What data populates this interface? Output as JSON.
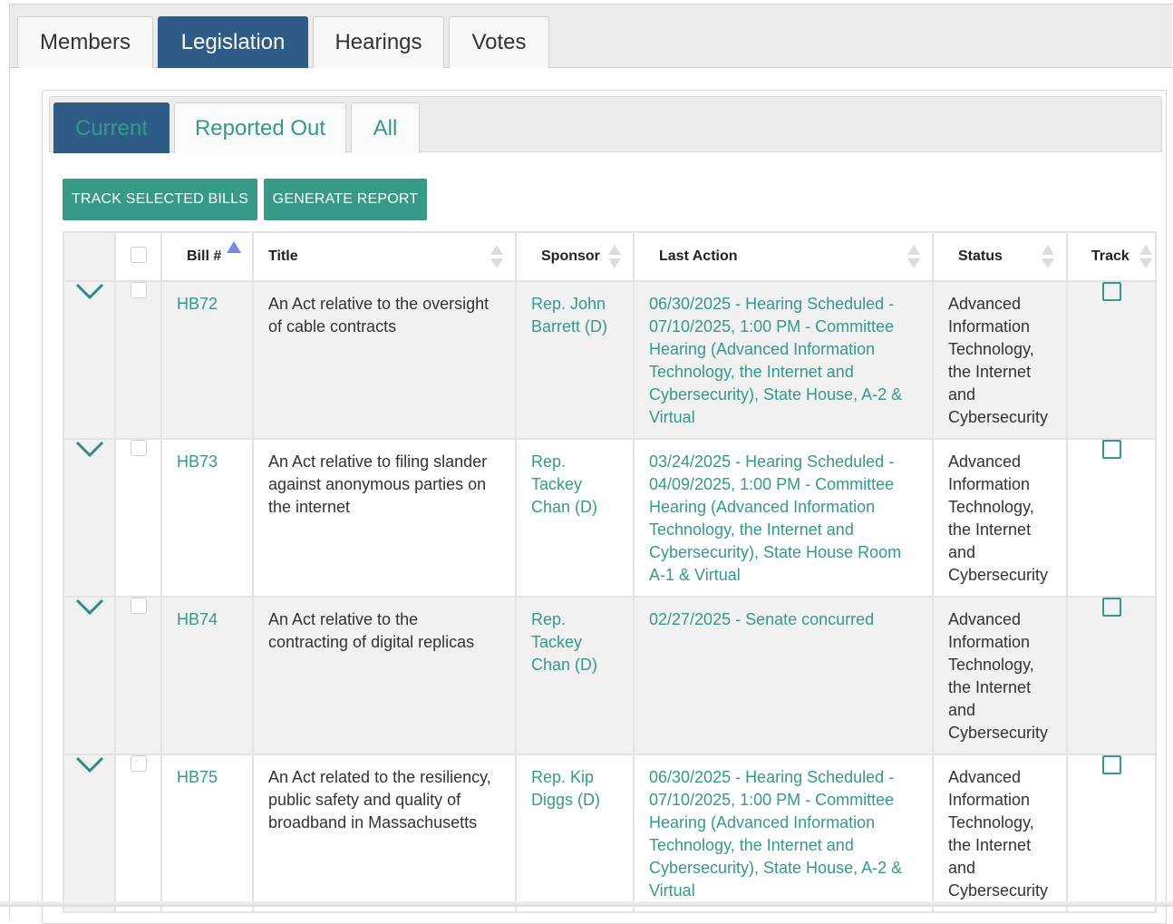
{
  "main_tabs": [
    {
      "label": "Members"
    },
    {
      "label": "Legislation"
    },
    {
      "label": "Hearings"
    },
    {
      "label": "Votes"
    }
  ],
  "main_active_tab": "Legislation",
  "sub_tabs": [
    {
      "label": "Current"
    },
    {
      "label": "Reported Out"
    },
    {
      "label": "All"
    }
  ],
  "sub_active_tab": "Current",
  "actions": {
    "track_selected": "TRACK SELECTED BILLS",
    "generate_report": "GENERATE REPORT"
  },
  "table": {
    "headers": {
      "bill": "Bill #",
      "title": "Title",
      "sponsor": "Sponsor",
      "last_action": "Last Action",
      "status": "Status",
      "track": "Track"
    },
    "sorted_column": "bill",
    "rows": [
      {
        "bill": "HB72",
        "title": "An Act relative to the oversight of cable contracts",
        "sponsor": "Rep. John Barrett (D)",
        "last_action": "06/30/2025 - Hearing Scheduled - 07/10/2025, 1:00 PM - Committee Hearing (Advanced Information Technology, the Internet and Cybersecurity), State House, A-2 & Virtual",
        "status": "Advanced Information Technology, the Internet and Cybersecurity"
      },
      {
        "bill": "HB73",
        "title": "An Act relative to filing slander against anonymous parties on the internet",
        "sponsor": "Rep. Tackey Chan (D)",
        "last_action": "03/24/2025 - Hearing Scheduled - 04/09/2025, 1:00 PM - Committee Hearing (Advanced Information Technology, the Internet and Cybersecurity), State House Room A-1 & Virtual",
        "status": "Advanced Information Technology, the Internet and Cybersecurity"
      },
      {
        "bill": "HB74",
        "title": "An Act relative to the contracting of digital replicas",
        "sponsor": "Rep. Tackey Chan (D)",
        "last_action": "02/27/2025 - Senate concurred",
        "status": "Advanced Information Technology, the Internet and Cybersecurity"
      },
      {
        "bill": "HB75",
        "title": "An Act related to the resiliency, public safety and quality of broadband in Massachusetts",
        "sponsor": "Rep. Kip Diggs (D)",
        "last_action": "06/30/2025 - Hearing Scheduled - 07/10/2025, 1:00 PM - Committee Hearing (Advanced Information Technology, the Internet and Cybersecurity), State House, A-2 & Virtual",
        "status": "Advanced Information Technology, the Internet and Cybersecurity"
      }
    ]
  },
  "colors": {
    "primary_navy": "#2e5c87",
    "accent_teal": "#35998b",
    "button_teal": "#369a86",
    "sort_active": "#7c87e6"
  },
  "icons": {
    "expand": "chevron-down-icon",
    "sort": "sort-arrows-icon",
    "sort_asc": "sort-ascending-icon"
  }
}
